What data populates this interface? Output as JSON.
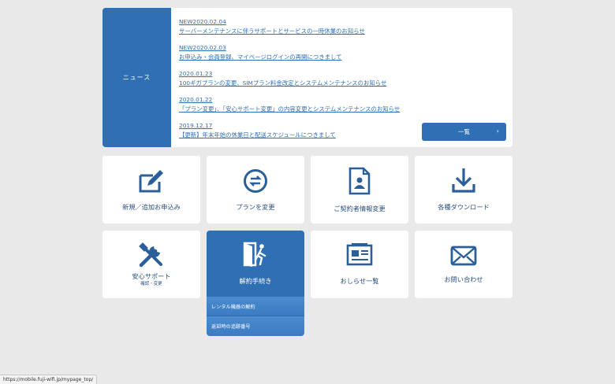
{
  "news": {
    "heading": "ニュース",
    "items": [
      {
        "date": "NEW2020.02.04",
        "title": "サーバーメンテナンスに伴うサポートとサービスの一時休業のお知らせ"
      },
      {
        "date": "NEW2020.02.03",
        "title": "お申込み・会員登録、マイページログインの再開につきまして"
      },
      {
        "date": "2020.01.23",
        "title": "100ギガプランの変更、SIMプラン料金改定とシステムメンテナンスのお知らせ"
      },
      {
        "date": "2020.01.22",
        "title": "「プラン変更」、「安心サポート変更」の内容変更とシステムメンテナンスのお知らせ"
      },
      {
        "date": "2019.12.17",
        "title": "【更新】年末年始の休業日と配送スケジュールにつきまして"
      }
    ],
    "list_button": "一覧"
  },
  "menu": {
    "new_application": "新規／追加お申込み",
    "change_plan": "プランを変更",
    "contract_info": "ご契約者情報変更",
    "downloads": "各種ダウンロード",
    "support": "安心サポート",
    "support_sub": "確認・変更",
    "cancellation": "解約手続き",
    "notices": "おしらせ一覧",
    "contact": "お問い合わせ"
  },
  "submenu": {
    "rental_cancel": "レンタル機器の解約",
    "return_tracking": "返却時の追跡番号"
  },
  "statusbar": {
    "url": "https://mobile.fuji-wifi.jp/mypage_top/"
  },
  "colors": {
    "accent": "#2f6fb3",
    "background": "#e9e9e9",
    "tile_text": "#2b4f7e"
  }
}
